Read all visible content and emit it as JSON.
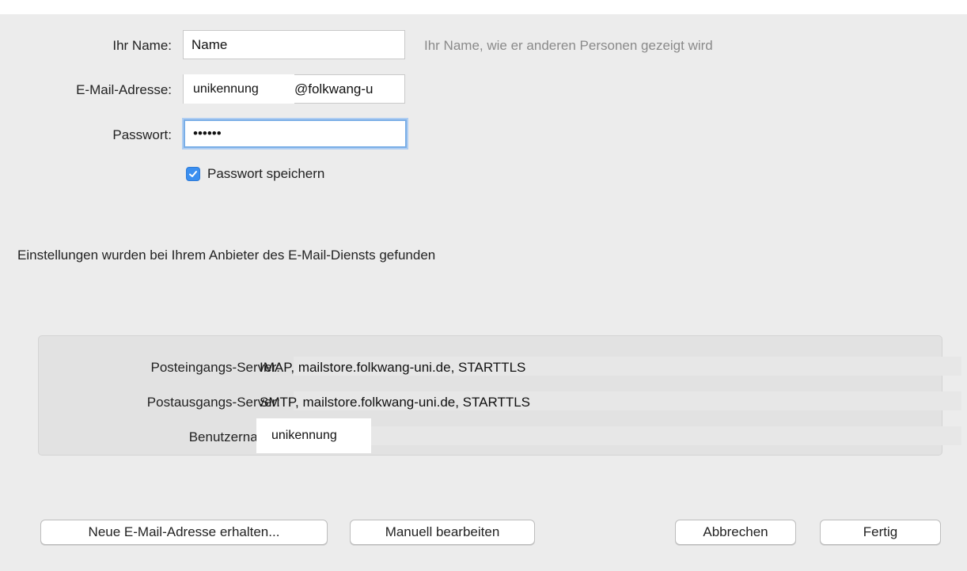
{
  "form": {
    "name_label": "Ihr Name:",
    "name_value": "Name",
    "name_hint": "Ihr Name, wie er anderen Personen gezeigt wird",
    "email_label": "E-Mail-Adresse:",
    "email_user": "unikennung",
    "email_domain": "@folkwang-u",
    "password_label": "Passwort:",
    "password_value": "••••••",
    "save_password_label": "Passwort speichern",
    "save_password_checked": true
  },
  "status_message": "Einstellungen wurden bei Ihrem Anbieter des E-Mail-Diensts gefunden",
  "server_info": {
    "incoming_label": "Posteingangs-Server:",
    "incoming_value": "IMAP, mailstore.folkwang-uni.de, STARTTLS",
    "outgoing_label": "Postausgangs-Server:",
    "outgoing_value": "SMTP, mailstore.folkwang-uni.de, STARTTLS",
    "username_label": "Benutzername:",
    "username_value": "unikennung"
  },
  "buttons": {
    "new_address": "Neue E-Mail-Adresse erhalten...",
    "manual_edit": "Manuell bearbeiten",
    "cancel": "Abbrechen",
    "done": "Fertig"
  },
  "colors": {
    "accent": "#3b8ff0",
    "focus_ring": "#7aaee6",
    "background": "#ececec"
  }
}
